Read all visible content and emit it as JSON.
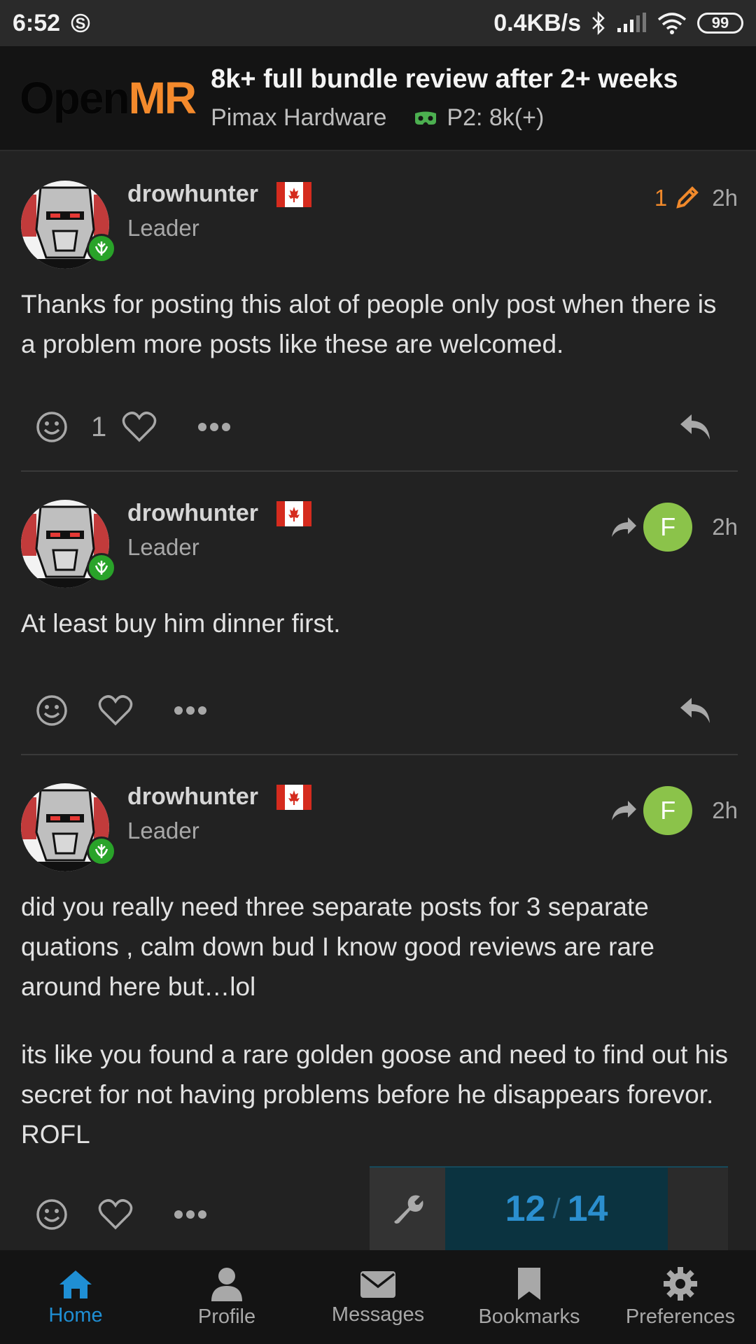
{
  "statusbar": {
    "time": "6:52",
    "net_speed": "0.4KB/s",
    "battery": "99"
  },
  "header": {
    "logo_open": "Open",
    "logo_mr": "MR",
    "title": "8k+ full bundle review after 2+ weeks",
    "category": "Pimax Hardware",
    "subcategory": "P2: 8k(+)",
    "subcategory_color": "#4caf50"
  },
  "posts": [
    {
      "username": "drowhunter",
      "user_title": "Leader",
      "edit_count": "1",
      "time": "2h",
      "body": [
        "Thanks for posting this alot of people only post when there is a problem more posts like these are welcomed."
      ],
      "like_count": "1"
    },
    {
      "username": "drowhunter",
      "user_title": "Leader",
      "reply_to_initial": "F",
      "time": "2h",
      "body": [
        "At least buy him dinner first."
      ]
    },
    {
      "username": "drowhunter",
      "user_title": "Leader",
      "reply_to_initial": "F",
      "time": "2h",
      "body": [
        "did you really need three separate posts for 3 separate quations , calm down bud I know good reviews are rare around here but…lol",
        "its like you found a rare golden goose and need to find out his secret for not having problems before he disappears forevor. ROFL"
      ]
    }
  ],
  "progress": {
    "current": "12",
    "separator": "/",
    "total": "14"
  },
  "nav": {
    "home": "Home",
    "profile": "Profile",
    "messages": "Messages",
    "bookmarks": "Bookmarks",
    "preferences": "Preferences"
  },
  "colors": {
    "accent": "#1f8fd4",
    "edit": "#f0892b",
    "reply_avatar": "#8bc34a"
  }
}
